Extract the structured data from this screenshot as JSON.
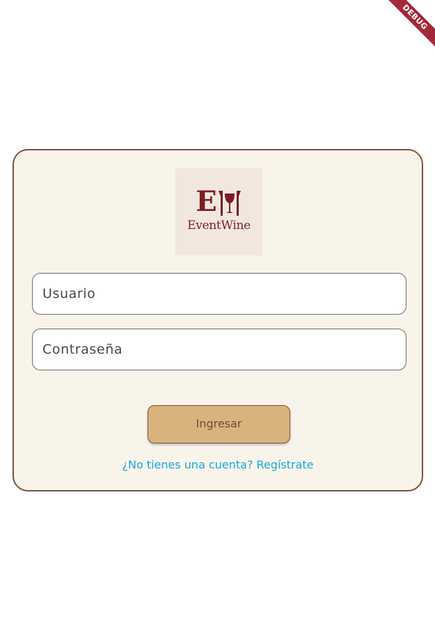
{
  "debug_banner": {
    "label": "DEBUG",
    "color": "#a3283a"
  },
  "logo": {
    "mark_letter": "E",
    "brand_name": "EventWine",
    "color": "#7a1e22",
    "background": "#f1e7df"
  },
  "form": {
    "username": {
      "placeholder": "Usuario",
      "value": ""
    },
    "password": {
      "placeholder": "Contraseña",
      "value": ""
    },
    "submit_label": "Ingresar",
    "register_link": "¿No tienes una cuenta? Regístrate"
  },
  "colors": {
    "card_background": "#f8f4ea",
    "card_border": "#7a5244",
    "button_background": "#d9b37d",
    "button_text": "#6e4a3a",
    "link": "#1aa6e0"
  }
}
